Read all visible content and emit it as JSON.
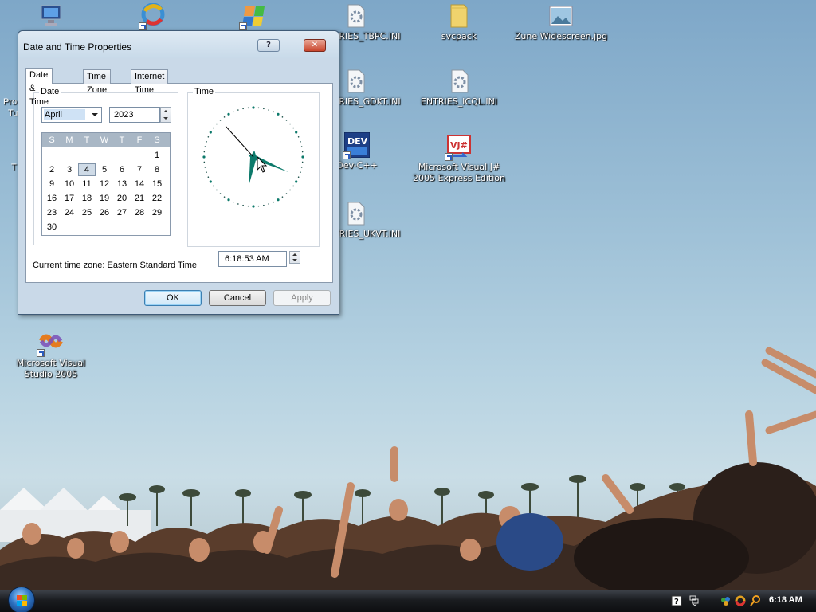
{
  "desktop": {
    "icons": [
      {
        "label": "",
        "icon": "computer-icon"
      },
      {
        "label": "",
        "icon": "browser-icon"
      },
      {
        "label": "",
        "icon": "media-player-icon"
      },
      {
        "label": "ENTRIES_TBPC.INI",
        "icon": "ini-file-icon"
      },
      {
        "label": "svcpack",
        "icon": "folder-icon"
      },
      {
        "label": "Zune Widescreen.jpg",
        "icon": "image-file-icon"
      },
      {
        "label": "ENTRIES_GDKT.INI",
        "icon": "ini-file-icon"
      },
      {
        "label": "ENTRIES_ICQL.INI",
        "icon": "ini-file-icon"
      },
      {
        "label": "Dev-C++",
        "icon": "devcpp-icon"
      },
      {
        "label": "Microsoft Visual J# 2005 Express Edition",
        "icon": "visual-jsharp-icon"
      },
      {
        "label": "ENTRIES_UKVT.INI",
        "icon": "ini-file-icon"
      },
      {
        "label": "Microsoft Visual Studio 2005",
        "icon": "visual-studio-icon"
      },
      {
        "label": "Pro",
        "icon": "partial-icon"
      },
      {
        "label": "Tu",
        "icon": "partial-icon"
      },
      {
        "label": "T",
        "icon": "partial-icon"
      }
    ]
  },
  "dialog": {
    "title": "Date and Time Properties",
    "help_label": "?",
    "close_label": "✕",
    "tabs": [
      "Date & Time",
      "Time Zone",
      "Internet Time"
    ],
    "date_group_label": "Date",
    "time_group_label": "Time",
    "month_value": "April",
    "year_value": "2023",
    "calendar": {
      "weekdays": [
        "S",
        "M",
        "T",
        "W",
        "T",
        "F",
        "S"
      ],
      "weeks": [
        [
          "",
          "",
          "",
          "",
          "",
          "",
          "1"
        ],
        [
          "2",
          "3",
          "4",
          "5",
          "6",
          "7",
          "8"
        ],
        [
          "9",
          "10",
          "11",
          "12",
          "13",
          "14",
          "15"
        ],
        [
          "16",
          "17",
          "18",
          "19",
          "20",
          "21",
          "22"
        ],
        [
          "23",
          "24",
          "25",
          "26",
          "27",
          "28",
          "29"
        ],
        [
          "30",
          "",
          "",
          "",
          "",
          "",
          ""
        ]
      ],
      "selected_day": "4"
    },
    "time_value": "6:18:53 AM",
    "current_timezone_label": "Current time zone:  Eastern Standard Time",
    "buttons": {
      "ok": "OK",
      "cancel": "Cancel",
      "apply": "Apply"
    },
    "clock_color": "#0d7a6b"
  },
  "taskbar": {
    "clock": "6:18 AM",
    "tray_icons": [
      "help-icon",
      "network-icon",
      "messenger-icon",
      "browser-icon",
      "search-icon"
    ]
  }
}
